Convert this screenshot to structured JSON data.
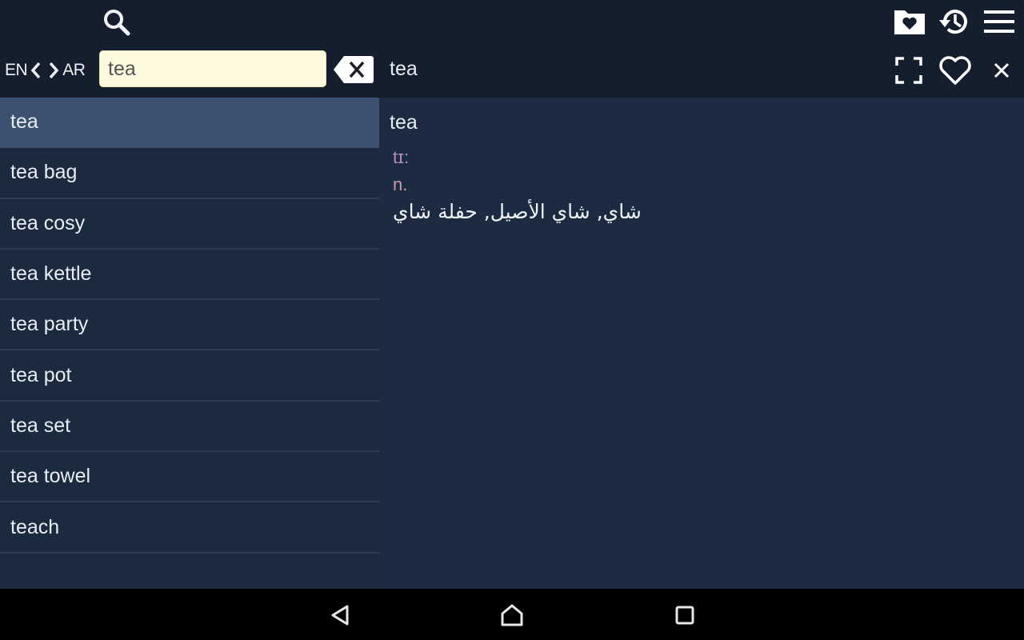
{
  "toolbar": {
    "search_icon": "search-icon",
    "actions": [
      {
        "name": "favorites-folder-icon"
      },
      {
        "name": "history-icon"
      },
      {
        "name": "menu-icon"
      }
    ]
  },
  "language": {
    "source": "EN",
    "target": "AR",
    "prev_icon": "chevron-left-icon",
    "next_icon": "chevron-right-icon"
  },
  "search": {
    "value": "tea",
    "placeholder": "",
    "clear_icon": "backspace-clear-icon"
  },
  "detail_header": {
    "word": "tea",
    "actions": [
      {
        "name": "fullscreen-icon"
      },
      {
        "name": "favorite-heart-icon"
      },
      {
        "name": "close-icon"
      }
    ]
  },
  "results": [
    {
      "label": "tea",
      "selected": true
    },
    {
      "label": "tea bag"
    },
    {
      "label": "tea cosy"
    },
    {
      "label": "tea kettle"
    },
    {
      "label": "tea party"
    },
    {
      "label": "tea pot"
    },
    {
      "label": "tea set"
    },
    {
      "label": "tea towel"
    },
    {
      "label": "teach"
    }
  ],
  "entry": {
    "word": "tea",
    "pronunciation": "tɪ:",
    "part_of_speech": "n.",
    "translation": "شاي, شاي الأصيل, حفلة شاي"
  },
  "navbar": {
    "back": "back-icon",
    "home": "home-icon",
    "recents": "recents-icon"
  },
  "colors": {
    "topbar": "#141e2d",
    "list_bg": "#1c2a40",
    "selected_row": "#3c5170",
    "search_bg": "#fdf9df",
    "pron": "#b58fbf",
    "pos": "#c89ca3"
  }
}
